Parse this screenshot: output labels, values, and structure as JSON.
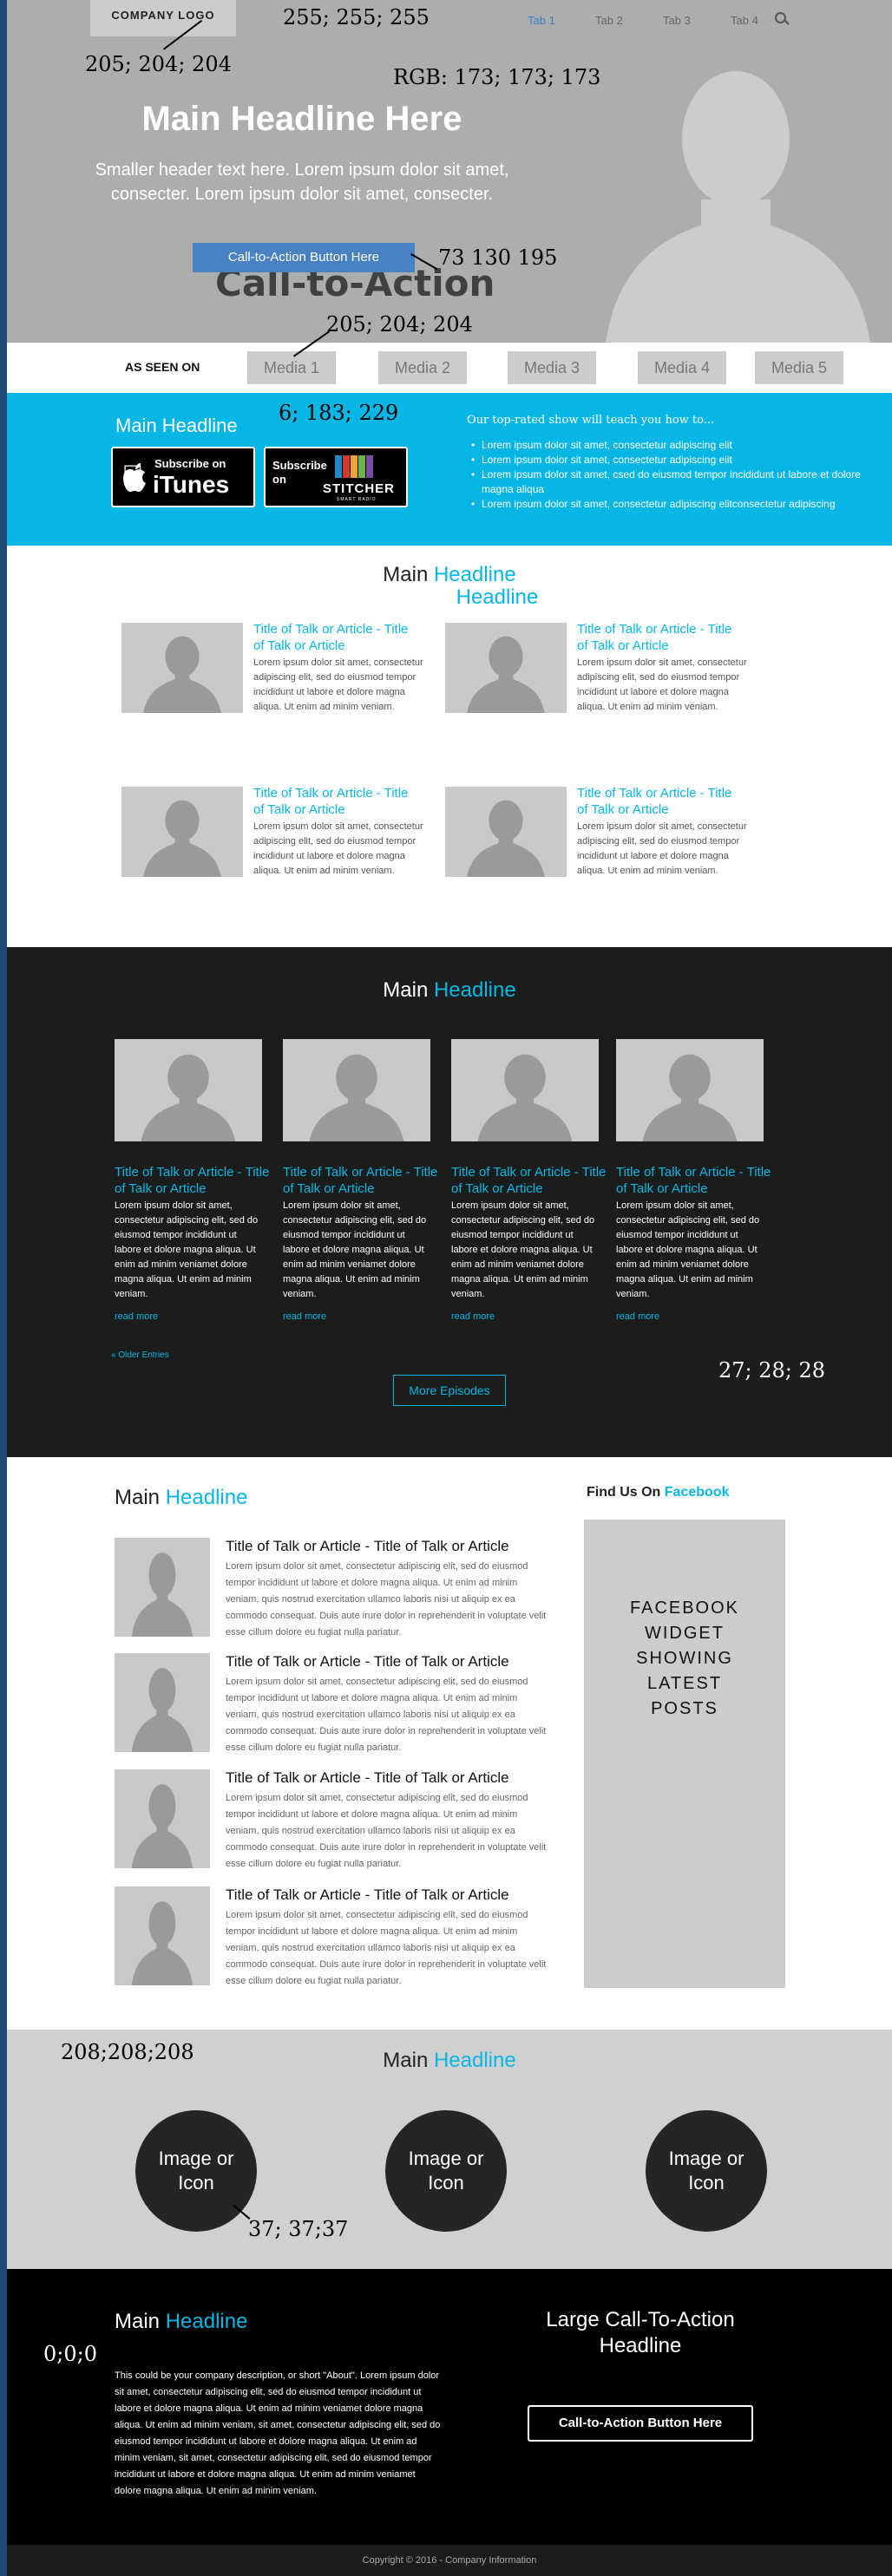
{
  "annotations": {
    "white_note": "255; 255; 255",
    "logo_note": "205; 204; 204",
    "hero_note": "RGB: 173; 173; 173",
    "button_note": "73 130 195",
    "media_note": "205; 204; 204",
    "cyan_note": "6; 183; 229",
    "dark_note": "27; 28; 28",
    "gray_note": "208;208;208",
    "circle_note": "37; 37;37",
    "black_note": "0;0;0",
    "colors": {
      "hero_bg": "#adadad",
      "logo_bg": "#cdcccc",
      "cta_button": "#4982c3",
      "cyan": "#06b7e5",
      "dark": "#1b1c1c",
      "light_gray": "#d0d0d0",
      "circle": "#252525",
      "footer": "#000000"
    }
  },
  "header": {
    "logo": "COMPANY LOGO",
    "tabs": [
      "Tab 1",
      "Tab 2",
      "Tab 3",
      "Tab 4"
    ],
    "active_tab": "Tab 1",
    "search_icon": "search-icon"
  },
  "hero": {
    "headline": "Main Headline Here",
    "subtext": "Smaller header text here. Lorem ipsum dolor sit amet, consecter. Lorem ipsum dolor sit amet, consecter.",
    "cta_button": "Call-to-Action Button Here",
    "cta_large": "Call-to-Action"
  },
  "media": {
    "label": "AS SEEN ON",
    "items": [
      "Media 1",
      "Media 2",
      "Media 3",
      "Media 4",
      "Media 5"
    ]
  },
  "subscribe": {
    "headline": "Main Headline",
    "itunes_small": "Subscribe on",
    "itunes_big": "iTunes",
    "stitcher_small": "Subscribe on",
    "stitcher_big": "STITCHER",
    "stitcher_tag": "SMART RADIO",
    "right_heading": "Our top-rated show will teach you how to...",
    "bullets": [
      "Lorem ipsum dolor sit amet, consectetur adipiscing elit",
      "Lorem ipsum dolor sit amet, consectetur adipiscing elit",
      "Lorem ipsum dolor sit amet, csed do eiusmod tempor incididunt ut labore et dolore magna aliqua",
      "Lorem ipsum dolor sit amet, consectetur adipiscing elitconsectetur adipiscing"
    ]
  },
  "articles": {
    "headline_a": "Main ",
    "headline_b": "Headline",
    "headline_c": "Headline",
    "title": "Title of Talk or Article - Title of Talk or Article",
    "text": "Lorem ipsum dolor sit amet, consectetur adipiscing elit, sed do eiusmod tempor incididunt ut labore et dolore magna aliqua. Ut enim ad minim veniam."
  },
  "episodes": {
    "headline_a": "Main ",
    "headline_b": "Headline",
    "title": "Title of Talk or Article - Title of Talk or Article",
    "text": "Lorem ipsum dolor sit amet, consectetur adipiscing elit, sed do eiusmod tempor incididunt ut labore et dolore magna aliqua. Ut enim ad minim veniamet dolore magna aliqua. Ut enim ad minim veniam.",
    "read_more": "read more",
    "older": "« Older Entries",
    "more_button": "More Episodes"
  },
  "list": {
    "headline_a": "Main ",
    "headline_b": "Headline",
    "title": "Title of Talk or Article - Title of Talk or Article",
    "text": "Lorem ipsum dolor sit amet, consectetur adipiscing elit, sed do eiusmod tempor incididunt ut labore et dolore magna aliqua. Ut enim ad minim veniam, quis nostrud exercitation ullamco laboris nisi ut aliquip ex ea commodo consequat. Duis aute irure dolor in reprehenderit in voluptate velit esse cillum dolore eu fugiat nulla pariatur.",
    "find_a": "Find Us On ",
    "find_b": "Facebook",
    "widget": "FACEBOOK\nWIDGET\nSHOWING\nLATEST\nPOSTS"
  },
  "icons": {
    "headline_a": "Main ",
    "headline_b": "Headline",
    "items": [
      "Image or\nIcon",
      "Image or\nIcon",
      "Image or\nIcon"
    ]
  },
  "footer": {
    "headline_a": "Main ",
    "headline_b": "Headline",
    "text": "This could be your company description, or short \"About\". Lorem ipsum dolor sit amet, consectetur adipiscing elit, sed do eiusmod tempor incididunt ut labore et dolore magna aliqua. Ut enim ad minim veniamet dolore magna aliqua. Ut enim ad minim veniam, sit amet, consectetur adipiscing elit, sed do eiusmod tempor incididunt ut labore et dolore magna aliqua. Ut enim ad minim veniam, sit amet, consectetur adipiscing elit, sed do eiusmod tempor incididunt ut labore et dolore magna aliqua. Ut enim ad minim veniamet dolore magna aliqua. Ut enim ad minim veniam.",
    "cta_headline": "Large Call-To-Action Headline",
    "cta_button": "Call-to-Action Button Here",
    "copyright": "Copyright © 2016 - Company Information"
  }
}
